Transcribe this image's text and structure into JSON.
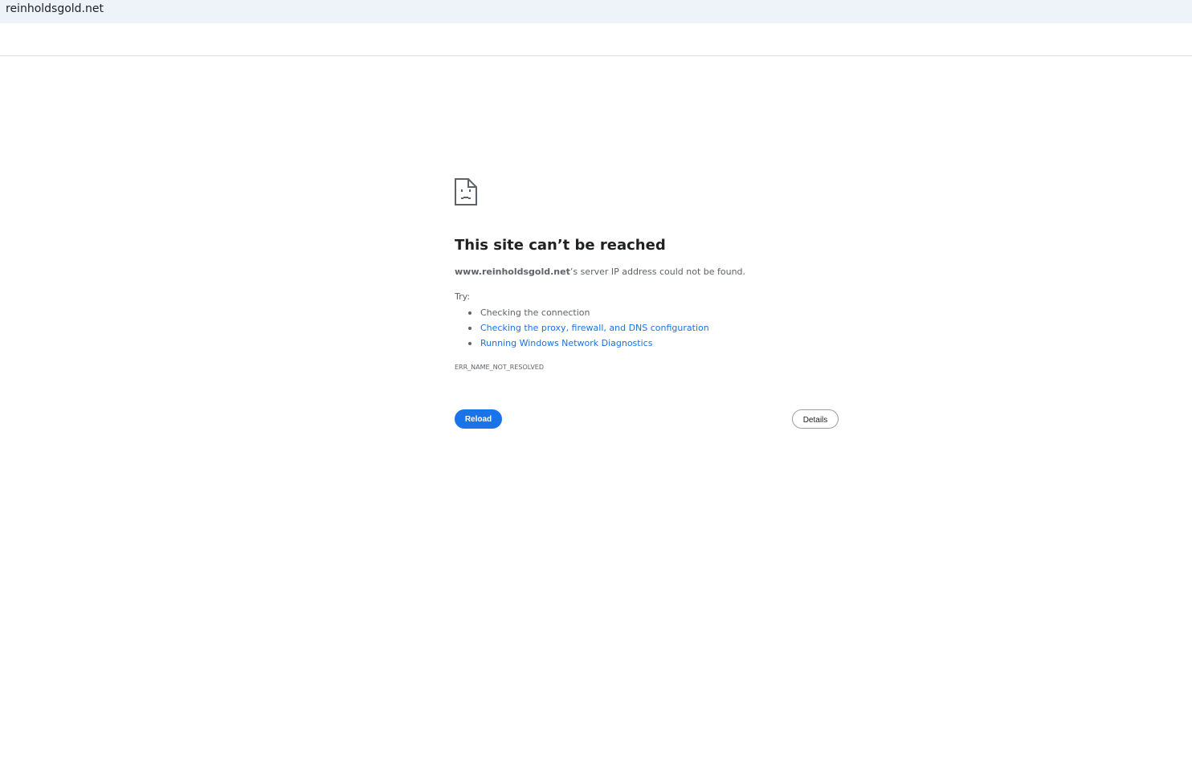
{
  "window": {
    "title": "reinholdsgold.net"
  },
  "error_page": {
    "heading": "This site can’t be reached",
    "host": "www.reinholdsgold.net",
    "message_suffix": "’s server IP address could not be found.",
    "try_label": "Try:",
    "suggestions": [
      {
        "text": "Checking the connection",
        "is_link": false
      },
      {
        "text": "Checking the proxy, firewall, and DNS configuration",
        "is_link": true
      },
      {
        "text": "Running Windows Network Diagnostics",
        "is_link": true
      }
    ],
    "error_code": "ERR_NAME_NOT_RESOLVED",
    "reload_label": "Reload",
    "details_label": "Details",
    "icon": "sad-page-icon"
  },
  "colors": {
    "accent": "#1a73e8",
    "titlebar_bg": "#eef2f9"
  }
}
